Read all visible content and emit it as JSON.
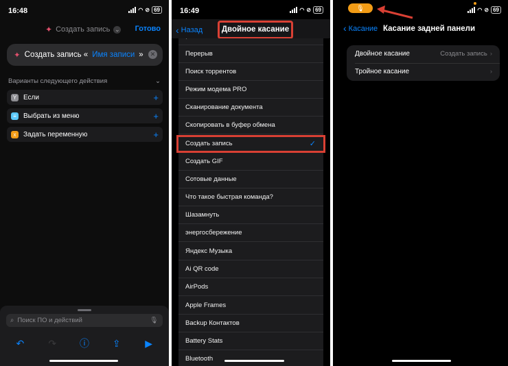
{
  "screen1": {
    "status": {
      "time": "16:48",
      "battery": "69"
    },
    "header": {
      "title": "Создать запись",
      "done": "Готово"
    },
    "action": {
      "prefix": "Создать запись «",
      "placeholder": "Имя записи",
      "suffix": "»"
    },
    "section": "Варианты следующего действия",
    "options": [
      "Если",
      "Выбрать из меню",
      "Задать переменную"
    ],
    "search_placeholder": "Поиск ПО и действий"
  },
  "screen2": {
    "status": {
      "time": "16:49",
      "battery": "69"
    },
    "nav": {
      "back": "Назад",
      "title": "Двойное касание"
    },
    "items": [
      "Перерыв",
      "Поиск торрентов",
      "Режим модема PRO",
      "Сканирование документа",
      "Скопировать в буфер обмена",
      "Создать запись",
      "Создать GIF",
      "Сотовые данные",
      "Что такое быстрая команда?",
      "Шазамнуть",
      "энергосбережение",
      "Яндекс Музыка",
      "Ai QR code",
      "AirPods",
      "Apple Frames",
      "Backup Контактов",
      "Battery Stats",
      "Bluetooth"
    ],
    "selected_index": 5
  },
  "screen3": {
    "status": {
      "battery": "69"
    },
    "nav": {
      "back": "Касание",
      "title": "Касание задней панели"
    },
    "rows": [
      {
        "label": "Двойное касание",
        "value": "Создать запись"
      },
      {
        "label": "Тройное касание",
        "value": ""
      }
    ]
  },
  "colors": {
    "accent": "#0a84ff",
    "highlight": "#d94034",
    "orange": "#f29c16"
  }
}
